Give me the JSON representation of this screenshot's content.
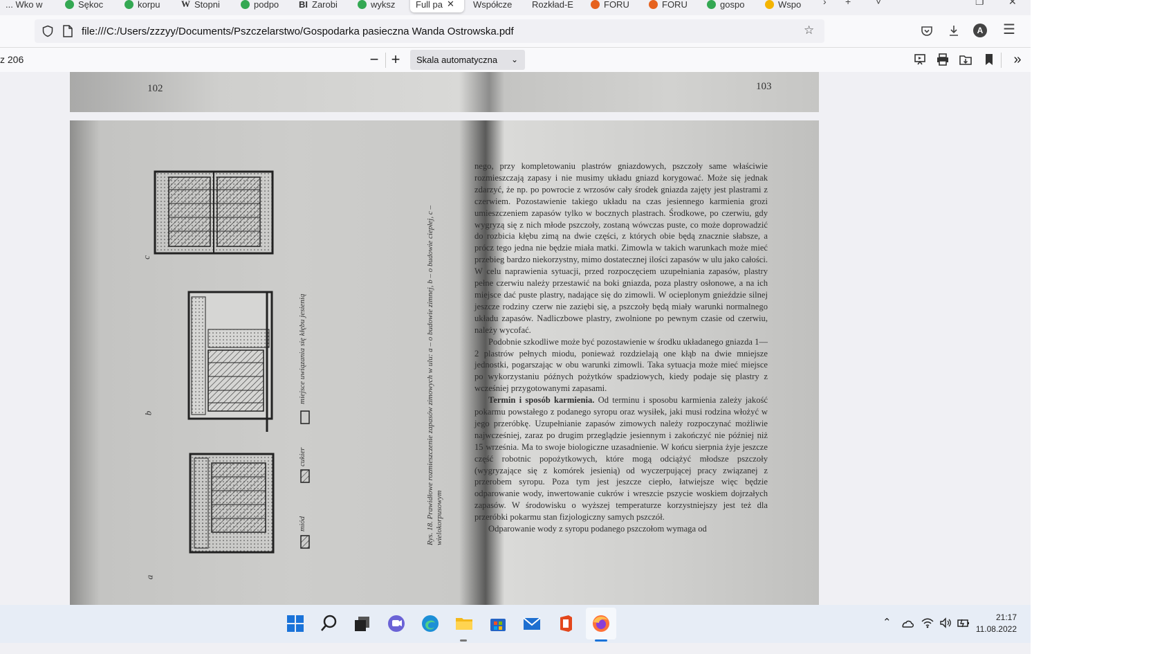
{
  "tabs": [
    {
      "label": "... Wko w",
      "color": ""
    },
    {
      "label": "Sękoc",
      "color": "#34a853"
    },
    {
      "label": "korpu",
      "color": "#34a853"
    },
    {
      "label": "Stopni",
      "color": "#555555"
    },
    {
      "label": "podpo",
      "color": "#34a853"
    },
    {
      "label": "Zarobi",
      "color": "#333333"
    },
    {
      "label": "wyksz",
      "color": "#34a853"
    },
    {
      "label": "Full pa",
      "color": "",
      "active": true
    },
    {
      "label": "Współcze",
      "color": ""
    },
    {
      "label": "Rozkład-E",
      "color": ""
    },
    {
      "label": "FORU",
      "color": "#e6621e"
    },
    {
      "label": "FORU",
      "color": "#e6621e"
    },
    {
      "label": "gospo",
      "color": "#34a853"
    },
    {
      "label": "Wspo",
      "color": "#f4b400"
    }
  ],
  "address": {
    "url": "file:///C:/Users/zzzyy/Documents/Pszczelarstwo/Gospodarka pasieczna Wanda Ostrowska.pdf"
  },
  "pdf_toolbar": {
    "page_count": "z 206",
    "zoom_out": "−",
    "zoom_in": "+",
    "scale_value": "Skala automatyczna"
  },
  "document": {
    "page_left_number": "102",
    "page_right_number": "103",
    "figure_caption": "Rys. 18. Prawidłowe rozmieszczenie zapasów zimowych w ulu: a – o budowie zimnej, b – o budowie ciepłej, c – wielokorpusowym",
    "legend_honey": "miód",
    "legend_sugar": "cukier",
    "legend_cluster": "miejsce uwiązania się kłębu jesienią",
    "fig_a": "a",
    "fig_b": "b",
    "fig_c": "c",
    "para1": "nego, przy kompletowaniu plastrów gniazdowych, pszczoły same właściwie rozmieszczają zapasy i nie musimy układu gniazd korygować. Może się jednak zdarzyć, że np. po powrocie z wrzosów cały środek gniazda zajęty jest plastrami z czerwiem. Pozostawienie takiego układu na czas jesiennego karmienia grozi umieszczeniem zapasów tylko w bocznych plastrach. Środkowe, po czerwiu, gdy wygryzą się z nich młode pszczoły, zostaną wówczas puste, co może doprowadzić do rozbicia kłębu zimą na dwie części, z których obie będą znacznie słabsze, a prócz tego jedna nie będzie miała matki. Zimowla w takich warunkach może mieć przebieg bardzo niekorzystny, mimo dostatecznej ilości zapasów w ulu jako całości. W celu naprawienia sytuacji, przed rozpoczęciem uzupełniania zapasów, plastry pełne czerwiu należy przestawić na boki gniazda, poza plastry osłonowe, a na ich miejsce dać puste plastry, nadające się do zimowli. W ocieplonym gnieździe silnej jeszcze rodziny czerw nie zaziębi się, a pszczoły będą miały warunki normalnego układu zapasów. Nadliczbowe plastry, zwolnione po pewnym czasie od czerwiu, należy wycofać.",
    "para2": "Podobnie szkodliwe może być pozostawienie w środku układanego gniazda 1—2 plastrów pełnych miodu, ponieważ rozdzielają one kłąb na dwie mniejsze jednostki, pogarszając w obu warunki zimowli. Taka sytuacja może mieć miejsce po wykorzystaniu późnych pożytków spadziowych, kiedy podaje się plastry z wcześniej przygotowanymi zapasami.",
    "para3_bold": "Termin i sposób karmienia.",
    "para3": " Od terminu i sposobu karmienia zależy jakość pokarmu powstałego z podanego syropu oraz wysiłek, jaki musi rodzina włożyć w jego przeróbkę. Uzupełnianie zapasów zimowych należy rozpoczynać możliwie najwcześniej, zaraz po drugim przeglądzie jesiennym i zakończyć nie później niż 15 września. Ma to swoje biologiczne uzasadnienie. W końcu sierpnia żyje jeszcze część robotnic popożytkowych, które mogą odciążyć młodsze pszczoły (wygryzające się z komórek jesienią) od wyczerpującej pracy związanej z przerobem syropu. Poza tym jest jeszcze ciepło, łatwiejsze więc będzie odparowanie wody, inwertowanie cukrów i wreszcie pszycie woskiem dojrzałych zapasów. W środowisku o wyższej temperaturze korzystniejszy jest też dla przeróbki pokarmu stan fizjologiczny samych pszczół.",
    "para4": "Odparowanie wody z syropu podanego pszczołom wymaga od"
  },
  "taskbar": {
    "time": "21:17",
    "date": "11.08.2022"
  }
}
